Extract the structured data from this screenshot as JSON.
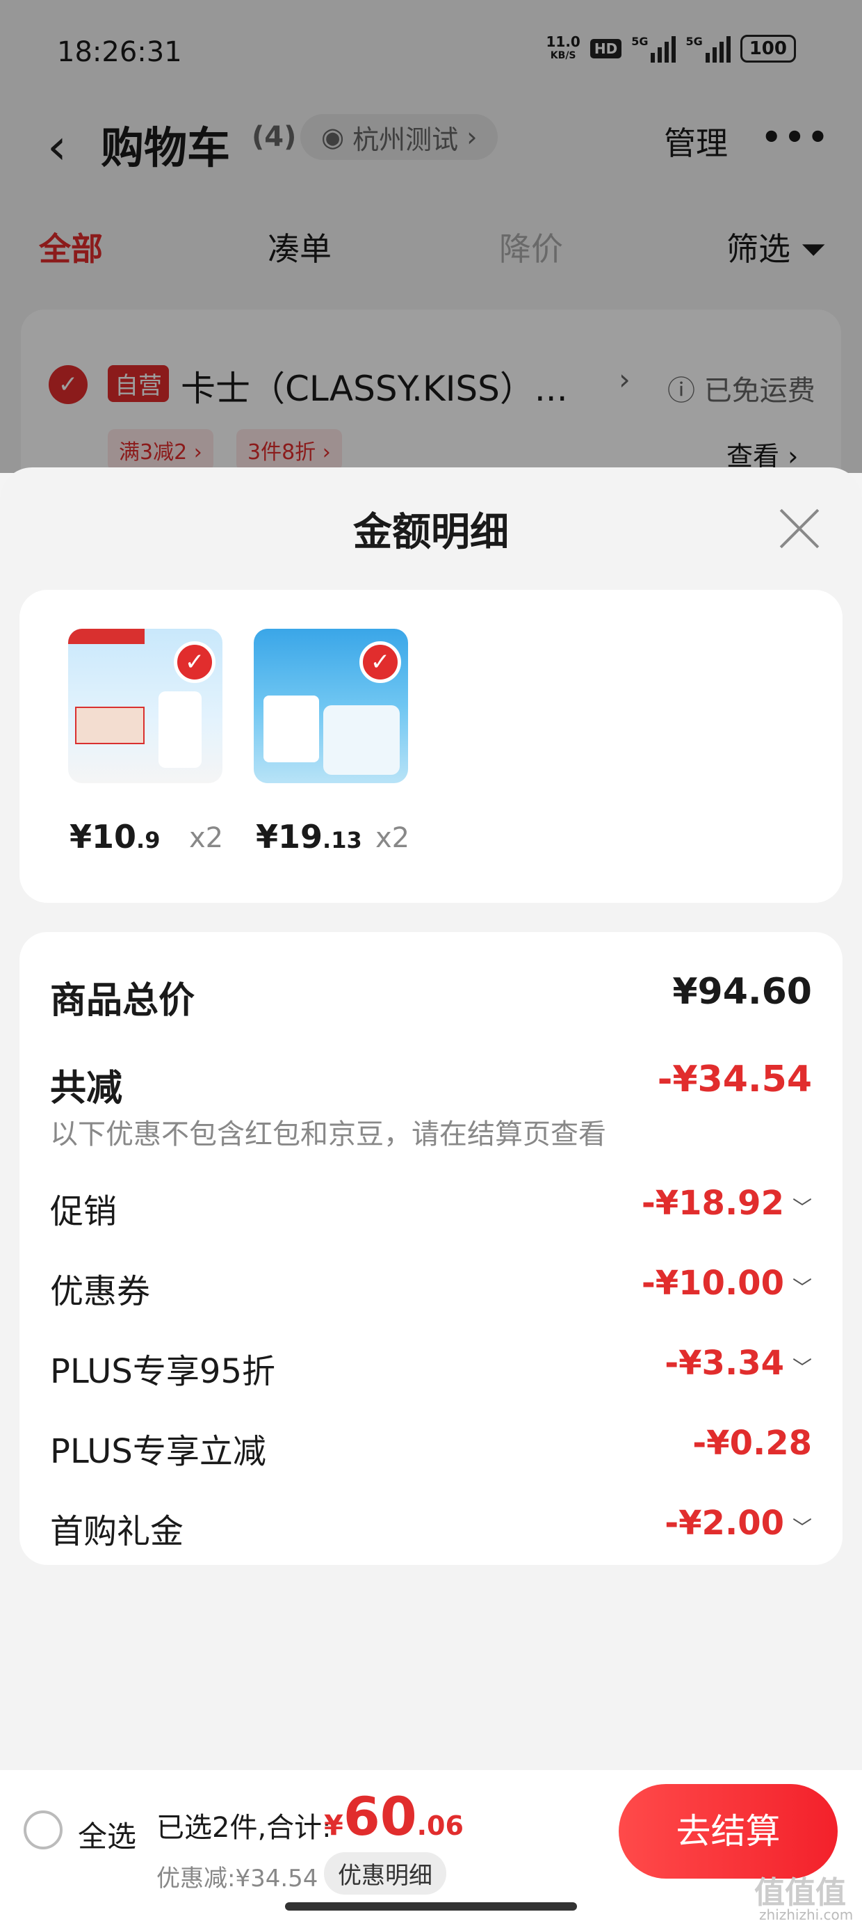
{
  "status_bar": {
    "time": "18:26:31",
    "net_speed_value": "11.0",
    "net_speed_unit": "KB/S",
    "hd": "HD",
    "sig1": "5G",
    "sig2": "5G",
    "battery": "100"
  },
  "nav": {
    "back_icon": "back-arrow-icon",
    "title": "购物车",
    "count": "(4)",
    "location": "杭州测试",
    "location_icon": "eye-icon",
    "manage": "管理",
    "more_icon": "more-dots-icon"
  },
  "tabs": [
    {
      "label": "全部"
    },
    {
      "label": "凑单"
    },
    {
      "label": "降价"
    },
    {
      "label": "筛选"
    }
  ],
  "shop": {
    "badge": "自营",
    "name": "卡士（CLASSY.KISS）...",
    "shipping": "已免运费",
    "promos": [
      "满3减2 ›",
      "3件8折 ›"
    ],
    "view": "查看 ›"
  },
  "sheet": {
    "title": "金额明细",
    "items": [
      {
        "price_int": "¥10",
        "price_dec": ".9",
        "qty": "x2"
      },
      {
        "price_int": "¥19",
        "price_dec": ".13",
        "qty": "x2"
      }
    ],
    "summary": {
      "goods_total_label": "商品总价",
      "goods_total_value": "¥94.60",
      "total_reduce_label": "共减",
      "total_reduce_value": "-¥34.54",
      "note": "以下优惠不包含红包和京豆，请在结算页查看",
      "lines": [
        {
          "label": "促销",
          "value": "-¥18.92",
          "chevron": true
        },
        {
          "label": "优惠券",
          "value": "-¥10.00",
          "chevron": true
        },
        {
          "label": "PLUS专享95折",
          "value": "-¥3.34",
          "chevron": true
        },
        {
          "label": "PLUS专享立减",
          "value": "-¥0.28",
          "chevron": false
        },
        {
          "label": "首购礼金",
          "value": "-¥2.00",
          "chevron": true
        }
      ]
    }
  },
  "bottom": {
    "select_all": "全选",
    "selected_text": "已选2件,合计:",
    "total_currency": "¥",
    "total_int": "60",
    "total_dec": ".06",
    "discount_text": "优惠减:¥34.54",
    "detail_button": "优惠明细",
    "checkout": "去结算"
  },
  "watermark": {
    "text": "值值值",
    "domain": "zhizhizhi.com"
  },
  "colors": {
    "accent": "#e12d2d"
  }
}
